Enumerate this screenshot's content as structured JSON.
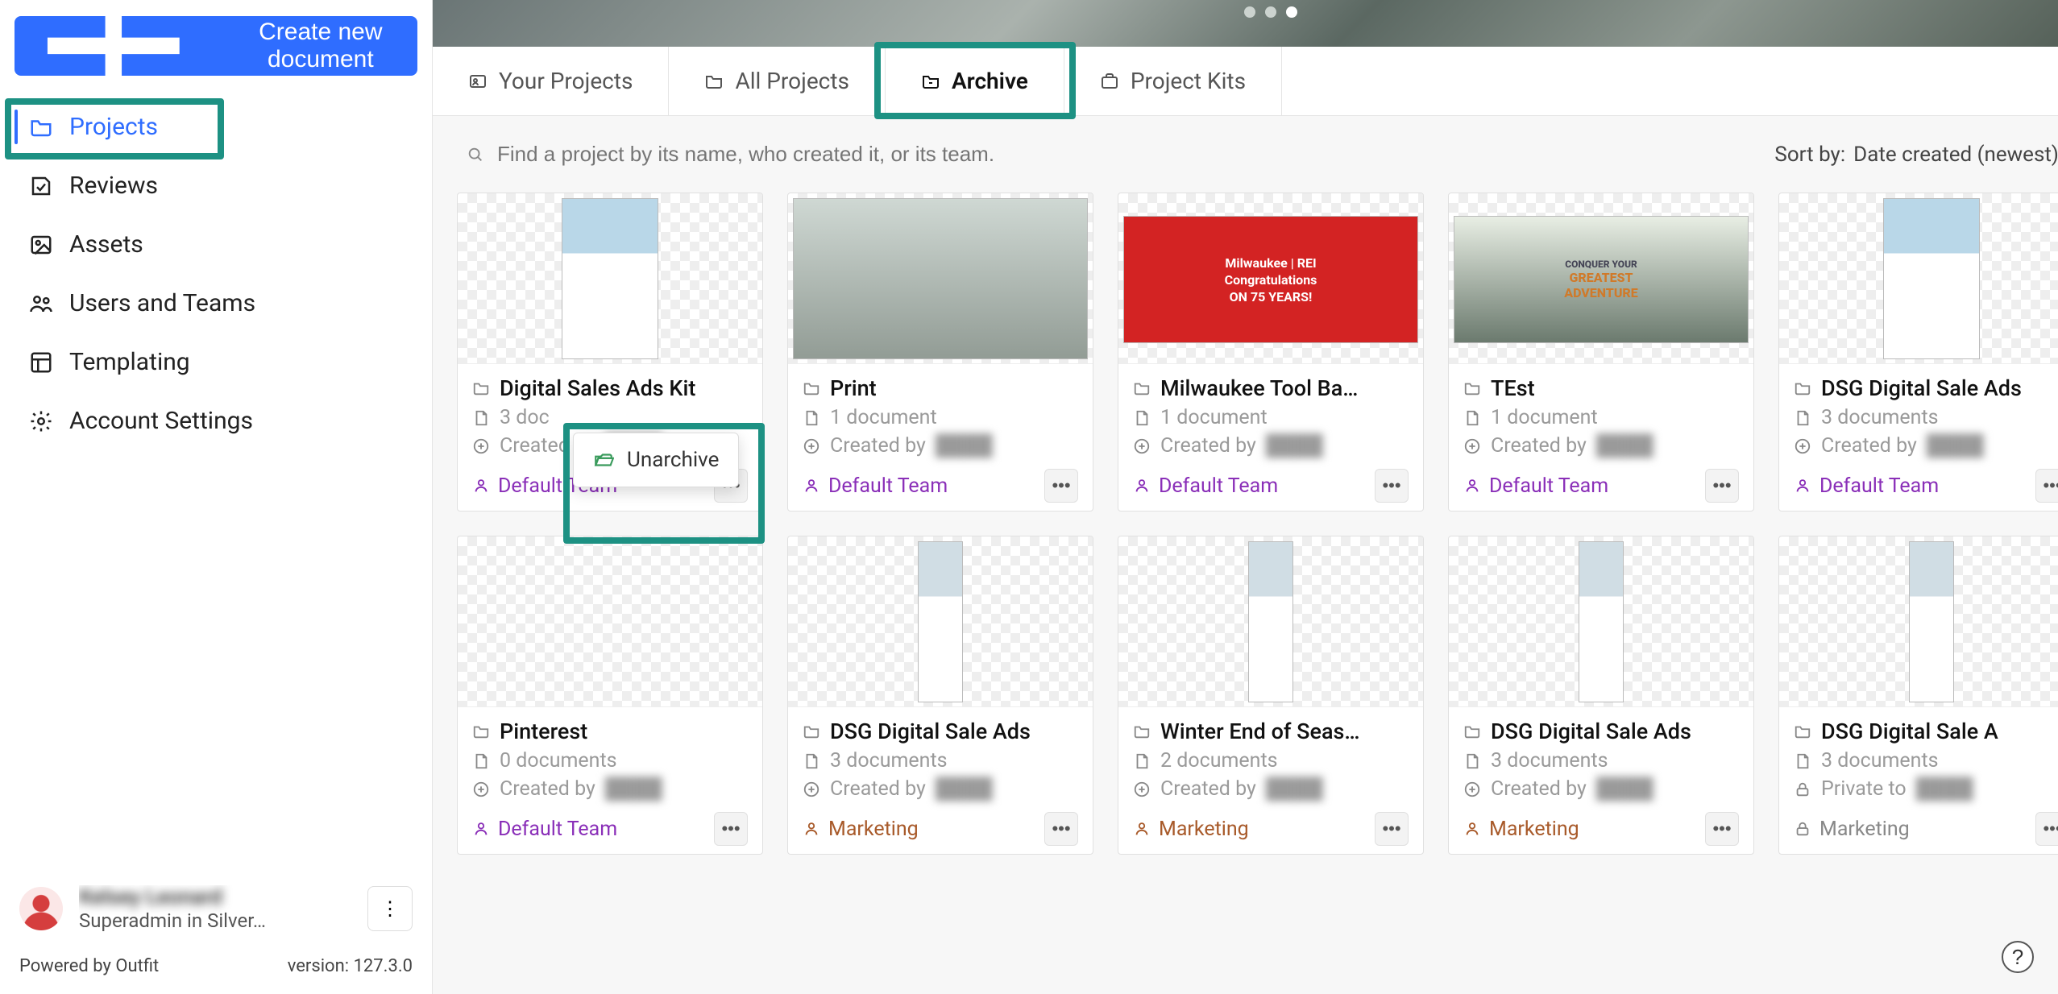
{
  "sidebar": {
    "create_label": "Create new document",
    "nav": [
      {
        "label": "Projects",
        "icon": "folder-icon",
        "active": true
      },
      {
        "label": "Reviews",
        "icon": "review-icon",
        "active": false
      },
      {
        "label": "Assets",
        "icon": "image-icon",
        "active": false
      },
      {
        "label": "Users and Teams",
        "icon": "people-icon",
        "active": false
      },
      {
        "label": "Templating",
        "icon": "template-icon",
        "active": false
      },
      {
        "label": "Account Settings",
        "icon": "gear-icon",
        "active": false
      }
    ],
    "user": {
      "name": "Kelsey Leonard",
      "role": "Superadmin in Silver…"
    },
    "footer": {
      "powered": "Powered by Outfit",
      "version_label": "version:",
      "version": "127.3.0"
    }
  },
  "tabs": [
    {
      "label": "Your Projects",
      "icon": "user-folder-icon",
      "active": false
    },
    {
      "label": "All Projects",
      "icon": "folder-icon",
      "active": false
    },
    {
      "label": "Archive",
      "icon": "archive-icon",
      "active": true
    },
    {
      "label": "Project Kits",
      "icon": "kit-icon",
      "active": false
    }
  ],
  "search": {
    "placeholder": "Find a project by its name, who created it, or its team."
  },
  "sort": {
    "label": "Sort by:",
    "value": "Date created (newest)"
  },
  "popover": {
    "label": "Unarchive"
  },
  "projects": [
    {
      "title": "Digital Sales Ads Kit",
      "docs": "3 doc",
      "created_by": "Created by",
      "creator": "████",
      "team": "Default Team",
      "team_style": "purple",
      "thumb": "flyer",
      "locked": false
    },
    {
      "title": "Print",
      "docs": "1 document",
      "created_by": "Created by",
      "creator": "████",
      "team": "Default Team",
      "team_style": "purple",
      "thumb": "mountain",
      "locked": false
    },
    {
      "title": "Milwaukee Tool Ba…",
      "docs": "1 document",
      "created_by": "Created by",
      "creator": "████",
      "team": "Default Team",
      "team_style": "purple",
      "thumb": "banner-red",
      "locked": false
    },
    {
      "title": "TEst",
      "docs": "1 document",
      "created_by": "Created by",
      "creator": "████",
      "team": "Default Team",
      "team_style": "purple",
      "thumb": "banner-adv",
      "locked": false
    },
    {
      "title": "DSG Digital Sale Ads",
      "docs": "3 documents",
      "created_by": "Created by",
      "creator": "████",
      "team": "Default Team",
      "team_style": "purple",
      "thumb": "flyer",
      "locked": false
    },
    {
      "title": "Pinterest",
      "docs": "0 documents",
      "created_by": "Created by",
      "creator": "████",
      "team": "Default Team",
      "team_style": "purple",
      "thumb": "blank",
      "locked": false
    },
    {
      "title": "DSG Digital Sale Ads",
      "docs": "3 documents",
      "created_by": "Created by",
      "creator": "████",
      "team": "Marketing",
      "team_style": "brown",
      "thumb": "sky",
      "locked": false
    },
    {
      "title": "Winter End of Seas…",
      "docs": "2 documents",
      "created_by": "Created by",
      "creator": "████",
      "team": "Marketing",
      "team_style": "brown",
      "thumb": "sky",
      "locked": false
    },
    {
      "title": "DSG Digital Sale Ads",
      "docs": "3 documents",
      "created_by": "Created by",
      "creator": "████",
      "team": "Marketing",
      "team_style": "brown",
      "thumb": "sky",
      "locked": false
    },
    {
      "title": "DSG Digital Sale A",
      "docs": "3 documents",
      "created_by": "Private to",
      "creator": "████",
      "team": "Marketing",
      "team_style": "grey",
      "thumb": "sky",
      "locked": true
    }
  ],
  "thumbs": {
    "banner-red": {
      "bg": "#d32323",
      "lines": [
        "Milwaukee | REI",
        "Congratulations",
        "ON 75 YEARS!"
      ]
    },
    "banner-adv": {
      "bg": "#e7efe4",
      "lines": [
        "CONQUER YOUR",
        "GREATEST",
        "ADVENTURE"
      ]
    }
  },
  "colors": {
    "accent": "#2f6dff",
    "highlight": "#1d9183",
    "team_purple": "#8a2fb8",
    "team_brown": "#a85a2a"
  }
}
